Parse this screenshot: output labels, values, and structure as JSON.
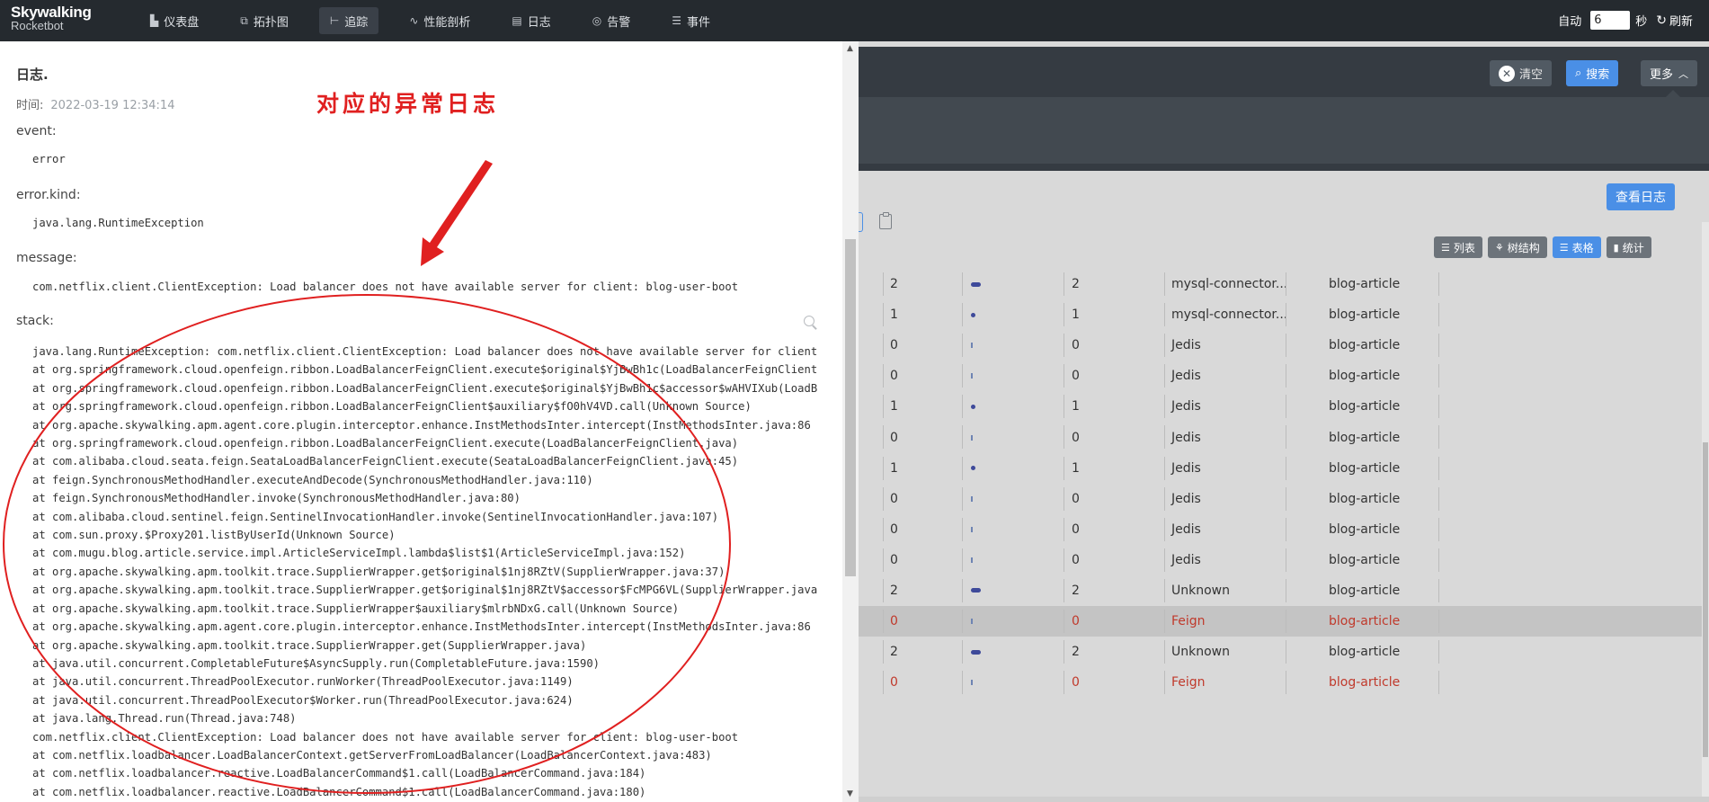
{
  "nav": {
    "logo_line1": "Skywalking",
    "logo_line2": "Rocketbot",
    "items": [
      {
        "label": "仪表盘",
        "icon": "dashboard-icon",
        "glyph": "▙"
      },
      {
        "label": "拓扑图",
        "icon": "topology-icon",
        "glyph": "⧉"
      },
      {
        "label": "追踪",
        "icon": "trace-icon",
        "glyph": "⊢"
      },
      {
        "label": "性能剖析",
        "icon": "profile-icon",
        "glyph": "∿"
      },
      {
        "label": "日志",
        "icon": "log-icon",
        "glyph": "▤"
      },
      {
        "label": "告警",
        "icon": "alarm-icon",
        "glyph": "◎"
      },
      {
        "label": "事件",
        "icon": "event-icon",
        "glyph": "☰"
      }
    ],
    "active_index": 2,
    "auto_label": "自动",
    "auto_value": "6",
    "seconds_label": "秒",
    "refresh_label": "刷新"
  },
  "toolbar": {
    "clear_label": "清空",
    "search_label": "搜索",
    "more_label": "更多",
    "view_log_label": "查看日志"
  },
  "view_buttons": [
    {
      "label": "列表",
      "icon": "list-icon",
      "glyph": "☰"
    },
    {
      "label": "树结构",
      "icon": "tree-icon",
      "glyph": "⚘"
    },
    {
      "label": "表格",
      "icon": "table-icon",
      "glyph": "☰",
      "active": true
    },
    {
      "label": "统计",
      "icon": "stats-icon",
      "glyph": "▮"
    }
  ],
  "table": {
    "rows": [
      {
        "c1": "2",
        "bar": "wide",
        "c2": "2",
        "component": "mysql-connector...",
        "service": "blog-article"
      },
      {
        "c1": "1",
        "bar": "dot",
        "c2": "1",
        "component": "mysql-connector...",
        "service": "blog-article"
      },
      {
        "c1": "0",
        "bar": "thin",
        "c2": "0",
        "component": "Jedis",
        "service": "blog-article"
      },
      {
        "c1": "0",
        "bar": "thin",
        "c2": "0",
        "component": "Jedis",
        "service": "blog-article"
      },
      {
        "c1": "1",
        "bar": "dot",
        "c2": "1",
        "component": "Jedis",
        "service": "blog-article"
      },
      {
        "c1": "0",
        "bar": "thin",
        "c2": "0",
        "component": "Jedis",
        "service": "blog-article"
      },
      {
        "c1": "1",
        "bar": "dot",
        "c2": "1",
        "component": "Jedis",
        "service": "blog-article"
      },
      {
        "c1": "0",
        "bar": "thin",
        "c2": "0",
        "component": "Jedis",
        "service": "blog-article"
      },
      {
        "c1": "0",
        "bar": "thin",
        "c2": "0",
        "component": "Jedis",
        "service": "blog-article"
      },
      {
        "c1": "0",
        "bar": "thin",
        "c2": "0",
        "component": "Jedis",
        "service": "blog-article"
      },
      {
        "c1": "2",
        "bar": "wide",
        "c2": "2",
        "component": "Unknown",
        "service": "blog-article"
      },
      {
        "c1": "0",
        "bar": "thin",
        "c2": "0",
        "component": "Feign",
        "service": "blog-article",
        "error": true,
        "selected": true
      },
      {
        "c1": "2",
        "bar": "wide",
        "c2": "2",
        "component": "Unknown",
        "service": "blog-article"
      },
      {
        "c1": "0",
        "bar": "thin",
        "c2": "0",
        "component": "Feign",
        "service": "blog-article",
        "error": true
      }
    ]
  },
  "drawer": {
    "title": "日志.",
    "time_label": "时间:",
    "time_value": "2022-03-19 12:34:14",
    "event_label": "event:",
    "event_value": "error",
    "error_kind_label": "error.kind:",
    "error_kind_value": "java.lang.RuntimeException",
    "message_label": "message:",
    "message_value": "com.netflix.client.ClientException: Load balancer does not have available server for client: blog-user-boot",
    "stack_label": "stack:",
    "stack_lines": [
      "java.lang.RuntimeException: com.netflix.client.ClientException: Load balancer does not have available server for client",
      "at org.springframework.cloud.openfeign.ribbon.LoadBalancerFeignClient.execute$original$YjBwBh1c(LoadBalancerFeignClient",
      "at org.springframework.cloud.openfeign.ribbon.LoadBalancerFeignClient.execute$original$YjBwBh1c$accessor$wAHVIXub(LoadB",
      "at org.springframework.cloud.openfeign.ribbon.LoadBalancerFeignClient$auxiliary$fO0hV4VD.call(Unknown Source)",
      "at org.apache.skywalking.apm.agent.core.plugin.interceptor.enhance.InstMethodsInter.intercept(InstMethodsInter.java:86",
      "at org.springframework.cloud.openfeign.ribbon.LoadBalancerFeignClient.execute(LoadBalancerFeignClient.java)",
      "at com.alibaba.cloud.seata.feign.SeataLoadBalancerFeignClient.execute(SeataLoadBalancerFeignClient.java:45)",
      "at feign.SynchronousMethodHandler.executeAndDecode(SynchronousMethodHandler.java:110)",
      "at feign.SynchronousMethodHandler.invoke(SynchronousMethodHandler.java:80)",
      "at com.alibaba.cloud.sentinel.feign.SentinelInvocationHandler.invoke(SentinelInvocationHandler.java:107)",
      "at com.sun.proxy.$Proxy201.listByUserId(Unknown Source)",
      "at com.mugu.blog.article.service.impl.ArticleServiceImpl.lambda$list$1(ArticleServiceImpl.java:152)",
      "at org.apache.skywalking.apm.toolkit.trace.SupplierWrapper.get$original$1nj8RZtV(SupplierWrapper.java:37)",
      "at org.apache.skywalking.apm.toolkit.trace.SupplierWrapper.get$original$1nj8RZtV$accessor$FcMPG6VL(SupplierWrapper.java",
      "at org.apache.skywalking.apm.toolkit.trace.SupplierWrapper$auxiliary$mlrbNDxG.call(Unknown Source)",
      "at org.apache.skywalking.apm.agent.core.plugin.interceptor.enhance.InstMethodsInter.intercept(InstMethodsInter.java:86",
      "at org.apache.skywalking.apm.toolkit.trace.SupplierWrapper.get(SupplierWrapper.java)",
      "at java.util.concurrent.CompletableFuture$AsyncSupply.run(CompletableFuture.java:1590)",
      "at java.util.concurrent.ThreadPoolExecutor.runWorker(ThreadPoolExecutor.java:1149)",
      "at java.util.concurrent.ThreadPoolExecutor$Worker.run(ThreadPoolExecutor.java:624)",
      "at java.lang.Thread.run(Thread.java:748)",
      "com.netflix.client.ClientException: Load balancer does not have available server for client: blog-user-boot",
      "at com.netflix.loadbalancer.LoadBalancerContext.getServerFromLoadBalancer(LoadBalancerContext.java:483)",
      "at com.netflix.loadbalancer.reactive.LoadBalancerCommand$1.call(LoadBalancerCommand.java:184)",
      "at com.netflix.loadbalancer.reactive.LoadBalancerCommand$1.call(LoadBalancerCommand.java:180)"
    ]
  },
  "annotation": {
    "text": "对应的异常日志",
    "color": "#e02020"
  },
  "colors": {
    "nav_bg": "#252a2f",
    "accent_blue": "#4a8fe6",
    "error_red": "#c0392b"
  }
}
